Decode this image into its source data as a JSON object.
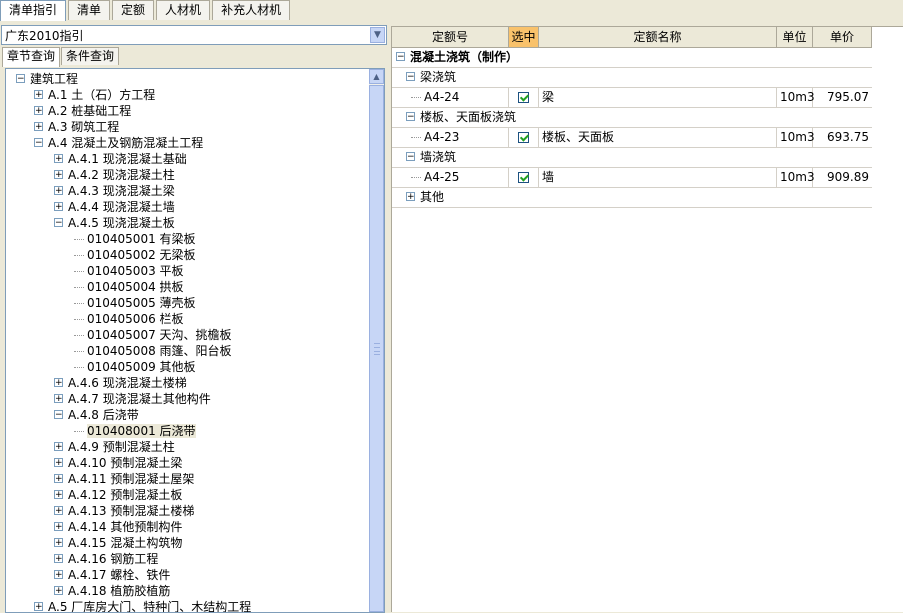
{
  "top_tabs": [
    {
      "label": "清单指引",
      "active": true
    },
    {
      "label": "清单",
      "active": false
    },
    {
      "label": "定额",
      "active": false
    },
    {
      "label": "人材机",
      "active": false
    },
    {
      "label": "补充人材机",
      "active": false
    }
  ],
  "combo": {
    "value": "广东2010指引"
  },
  "sub_tabs": [
    {
      "label": "章节查询",
      "active": true
    },
    {
      "label": "条件查询",
      "active": false
    }
  ],
  "tree": [
    {
      "level": 0,
      "exp": "-",
      "label": "建筑工程"
    },
    {
      "level": 1,
      "exp": "+",
      "label": "A.1 土（石）方工程"
    },
    {
      "level": 1,
      "exp": "+",
      "label": "A.2 桩基础工程"
    },
    {
      "level": 1,
      "exp": "+",
      "label": "A.3 砌筑工程"
    },
    {
      "level": 1,
      "exp": "-",
      "label": "A.4 混凝土及钢筋混凝土工程"
    },
    {
      "level": 2,
      "exp": "+",
      "label": "A.4.1 现浇混凝土基础"
    },
    {
      "level": 2,
      "exp": "+",
      "label": "A.4.2 现浇混凝土柱"
    },
    {
      "level": 2,
      "exp": "+",
      "label": "A.4.3 现浇混凝土梁"
    },
    {
      "level": 2,
      "exp": "+",
      "label": "A.4.4 现浇混凝土墙"
    },
    {
      "level": 2,
      "exp": "-",
      "label": "A.4.5 现浇混凝土板"
    },
    {
      "level": 3,
      "exp": "",
      "label": "010405001  有梁板"
    },
    {
      "level": 3,
      "exp": "",
      "label": "010405002  无梁板"
    },
    {
      "level": 3,
      "exp": "",
      "label": "010405003  平板"
    },
    {
      "level": 3,
      "exp": "",
      "label": "010405004  拱板"
    },
    {
      "level": 3,
      "exp": "",
      "label": "010405005  薄壳板"
    },
    {
      "level": 3,
      "exp": "",
      "label": "010405006  栏板"
    },
    {
      "level": 3,
      "exp": "",
      "label": "010405007  天沟、挑檐板"
    },
    {
      "level": 3,
      "exp": "",
      "label": "010405008  雨篷、阳台板"
    },
    {
      "level": 3,
      "exp": "",
      "label": "010405009  其他板"
    },
    {
      "level": 2,
      "exp": "+",
      "label": "A.4.6 现浇混凝土楼梯"
    },
    {
      "level": 2,
      "exp": "+",
      "label": "A.4.7 现浇混凝土其他构件"
    },
    {
      "level": 2,
      "exp": "-",
      "label": "A.4.8 后浇带"
    },
    {
      "level": 3,
      "exp": "",
      "label": "010408001  后浇带",
      "selected": true
    },
    {
      "level": 2,
      "exp": "+",
      "label": "A.4.9 预制混凝土柱"
    },
    {
      "level": 2,
      "exp": "+",
      "label": "A.4.10 预制混凝土梁"
    },
    {
      "level": 2,
      "exp": "+",
      "label": "A.4.11 预制混凝土屋架"
    },
    {
      "level": 2,
      "exp": "+",
      "label": "A.4.12 预制混凝土板"
    },
    {
      "level": 2,
      "exp": "+",
      "label": "A.4.13 预制混凝土楼梯"
    },
    {
      "level": 2,
      "exp": "+",
      "label": "A.4.14 其他预制构件"
    },
    {
      "level": 2,
      "exp": "+",
      "label": "A.4.15 混凝土构筑物"
    },
    {
      "level": 2,
      "exp": "+",
      "label": "A.4.16 钢筋工程"
    },
    {
      "level": 2,
      "exp": "+",
      "label": "A.4.17 螺栓、铁件"
    },
    {
      "level": 2,
      "exp": "+",
      "label": "A.4.18 植筋胶植筋"
    },
    {
      "level": 1,
      "exp": "+",
      "label": "A.5 厂库房大门、特种门、木结构工程"
    }
  ],
  "grid": {
    "headers": {
      "code": "定额号",
      "select": "选中",
      "name": "定额名称",
      "unit": "单位",
      "price": "单价"
    },
    "root": {
      "label": "混凝土浇筑（制作）"
    },
    "groups": [
      {
        "label": "梁浇筑",
        "items": [
          {
            "code": "A4-24",
            "name": "梁",
            "unit": "10m3",
            "price": "795.07",
            "checked": true
          }
        ]
      },
      {
        "label": "楼板、天面板浇筑",
        "items": [
          {
            "code": "A4-23",
            "name": "楼板、天面板",
            "unit": "10m3",
            "price": "693.75",
            "checked": true
          }
        ]
      },
      {
        "label": "墙浇筑",
        "items": [
          {
            "code": "A4-25",
            "name": "墙",
            "unit": "10m3",
            "price": "909.89",
            "checked": true
          }
        ]
      }
    ],
    "other": {
      "label": "其他"
    }
  }
}
